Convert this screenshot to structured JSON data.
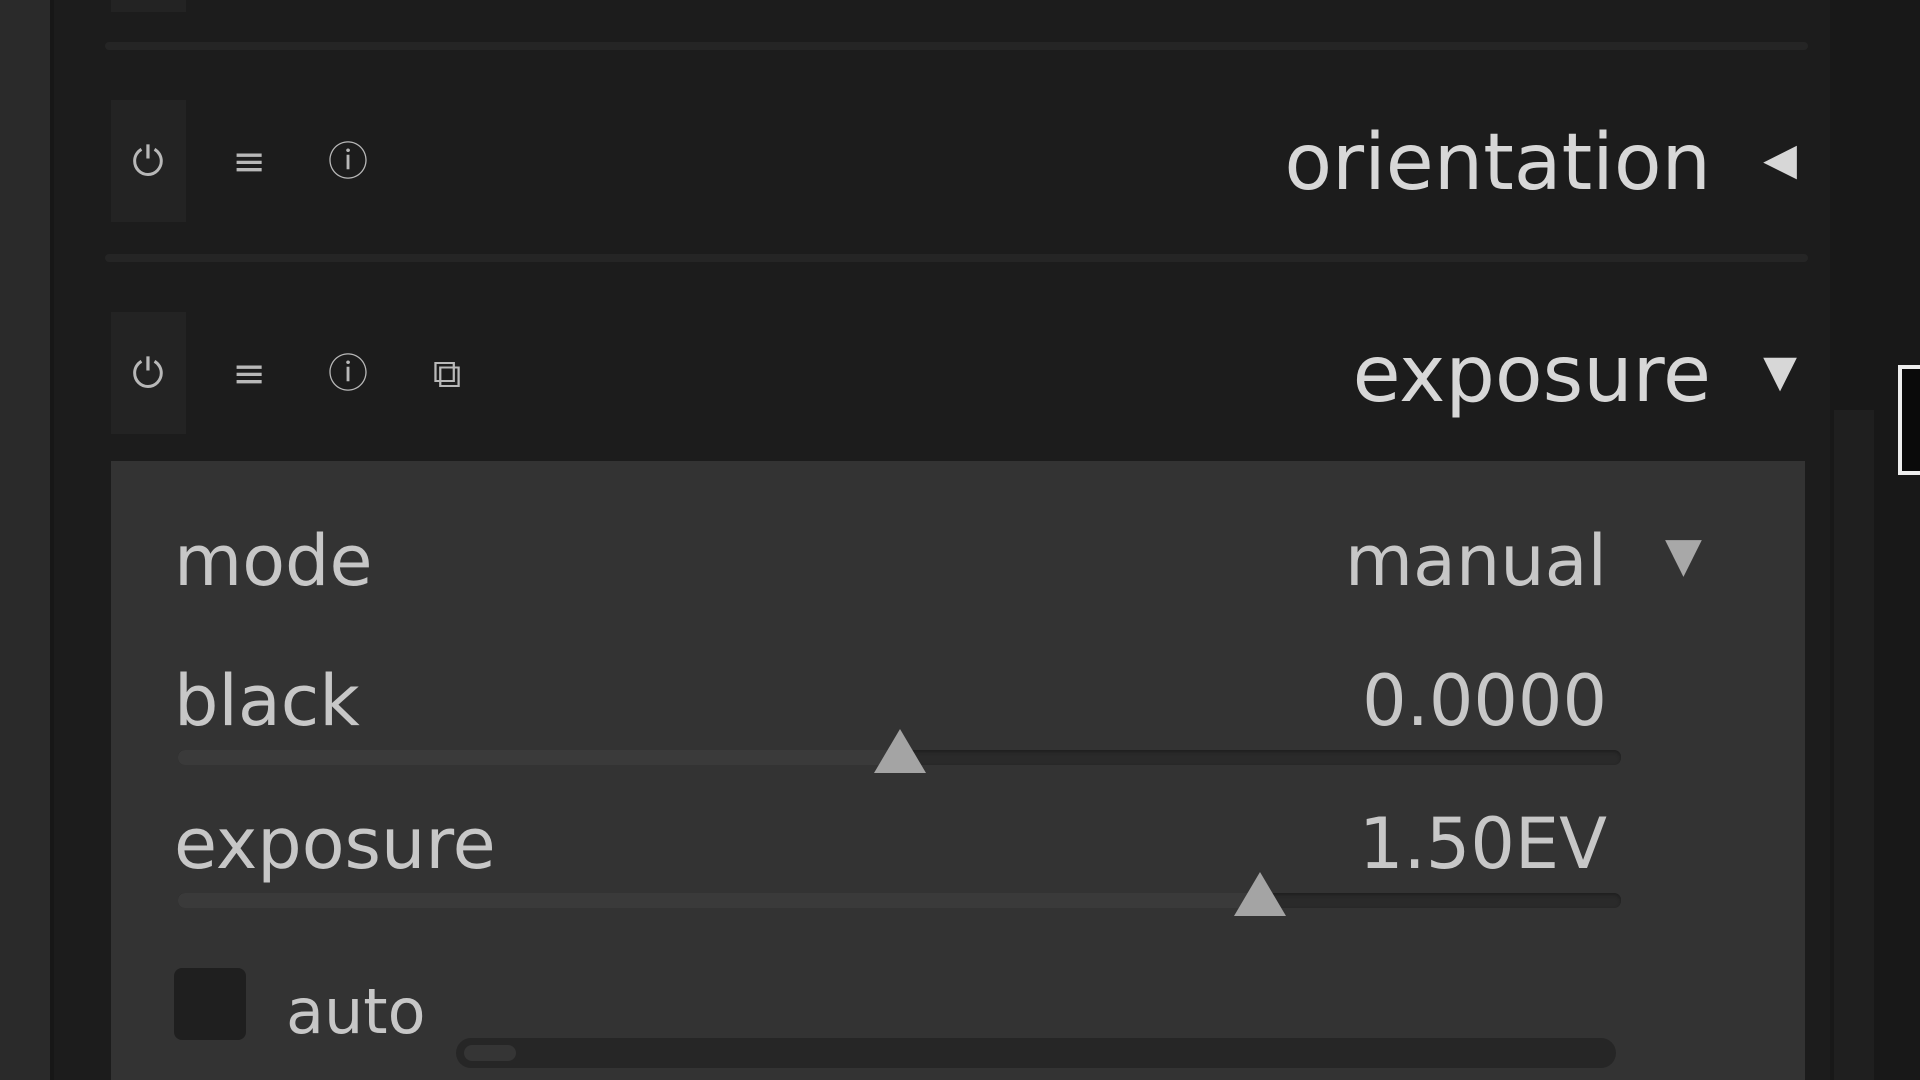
{
  "modules": {
    "orientation": {
      "title": "orientation",
      "arrow": "◀",
      "expanded": false,
      "icons": [
        "power-icon",
        "presets-icon",
        "instance-icon"
      ]
    },
    "exposure": {
      "title": "exposure",
      "arrow": "▼",
      "expanded": true,
      "icons": [
        "power-icon",
        "presets-icon",
        "instance-icon",
        "multi-instance-icon"
      ],
      "mode": {
        "label": "mode",
        "value": "manual",
        "arrow": "▼"
      },
      "black": {
        "label": "black",
        "value": "0.0000",
        "position": 0.5
      },
      "exposure": {
        "label": "exposure",
        "value": "1.50EV",
        "position": 0.75
      },
      "auto": {
        "label": "auto",
        "checked": false
      }
    }
  },
  "icon_glyphs": {
    "power-icon": "⏻",
    "presets-icon": "≡",
    "instance-icon": "ⓘ",
    "multi-instance-icon": "⧉"
  },
  "colors": {
    "panel_bg": "#1c1c1c",
    "module_body_bg": "#333333",
    "text": "#c7c7c7",
    "title_text": "#d7d7d7"
  }
}
